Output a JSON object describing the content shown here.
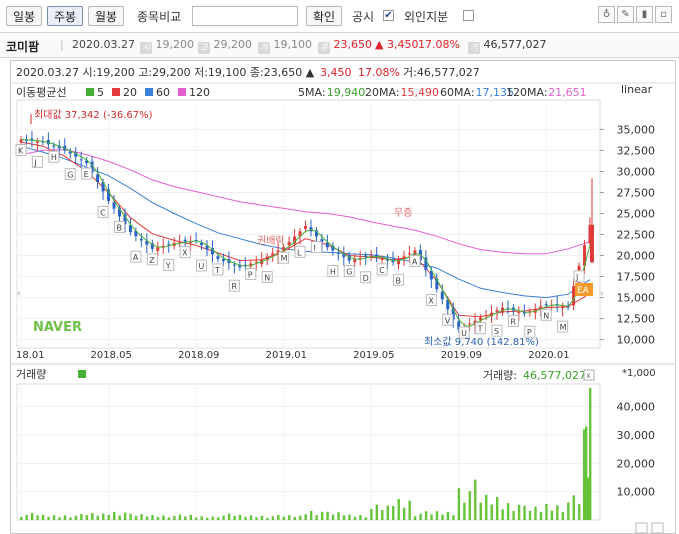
{
  "toolbar": {
    "day_label": "일봉",
    "week_label": "주봉",
    "month_label": "월봉",
    "compare_label": "종목비교",
    "confirm_label": "확인",
    "disclosure_label": "공시",
    "foreign_label": "외인지분"
  },
  "info": {
    "name": "코미팜",
    "date": "2020.03.27",
    "open_icon": "시",
    "open": "19,200",
    "high_icon": "고",
    "high": "29,200",
    "low_icon": "저",
    "low": "19,100",
    "close_icon": "종",
    "close": "23,650",
    "change": "▲ 3,450",
    "pct": "17.08%",
    "volume_icon": "거",
    "volume": "46,577,027"
  },
  "chart_header": {
    "ohlc": "2020.03.27 시:19,200 고:29,200 저:19,100 종:23,650 ▲",
    "change": "3,450",
    "pct": "17.08%",
    "volume": "거:46,577,027",
    "ma_title": "이동평균선",
    "ma_items": [
      {
        "label": "5",
        "color": "#45b035"
      },
      {
        "label": "20",
        "color": "#e23a3a"
      },
      {
        "label": "60",
        "color": "#3a7fd8"
      },
      {
        "label": "120",
        "color": "#e35fcf"
      }
    ],
    "ma_values": [
      {
        "label": "5MA:",
        "value": "19,940",
        "color": "#3aa02a"
      },
      {
        "label": "20MA:",
        "value": "15,490",
        "color": "#e23a3a"
      },
      {
        "label": "60MA:",
        "value": "17,135",
        "color": "#3a7fd8"
      },
      {
        "label": "120MA:",
        "value": "21,651",
        "color": "#e35fcf"
      }
    ],
    "scale": "linear",
    "max_label": "최대값 37,342 (-36.67%)",
    "min_label": "최소값 9,740 (142.81%)",
    "annot1": "권배락",
    "annot2": "무증",
    "watermark": "NAVER",
    "volume_title": "거래량",
    "volume_value_label": "거래량:",
    "volume_value": "46,577,027",
    "volume_unit": "*1,000"
  },
  "chart_data": [
    {
      "type": "candlestick",
      "title": "",
      "x": [
        "18.01",
        "18.02",
        "18.03",
        "18.04",
        "18.05",
        "18.06",
        "18.07",
        "18.08",
        "18.09",
        "18.10",
        "18.11",
        "18.12",
        "19.01",
        "19.02",
        "19.03",
        "19.04",
        "19.05",
        "19.06",
        "19.07",
        "19.08",
        "19.09",
        "19.10",
        "19.11",
        "19.12",
        "20.01",
        "20.02",
        "20.03"
      ],
      "x_tick_labels": [
        "18.01",
        "2018.05",
        "2018.09",
        "2019.01",
        "2019.05",
        "2019.09",
        "2020.01"
      ],
      "y_tick_labels": [
        "10,000",
        "12,500",
        "15,000",
        "17,500",
        "20,000",
        "22,500",
        "25,000",
        "27,500",
        "30,000",
        "32,500",
        "35,000"
      ],
      "ylim": [
        9000,
        38500
      ],
      "close": [
        33800,
        33500,
        32500,
        31000,
        26500,
        22800,
        20800,
        21500,
        21800,
        19600,
        18600,
        19500,
        21000,
        23500,
        21000,
        19400,
        20000,
        19200,
        20600,
        16000,
        11200,
        12600,
        13800,
        13100,
        14200,
        13900,
        23650
      ],
      "ma_120_approx": [
        32000,
        32500,
        32600,
        32000,
        31200,
        30200,
        29000,
        28200,
        27600,
        27000,
        26400,
        26000,
        25600,
        25200,
        25000,
        24600,
        24000,
        23500,
        23000,
        22300,
        21400,
        20700,
        20400,
        20200,
        20200,
        20800,
        21651
      ],
      "ma_60_approx": [
        33000,
        32300,
        31500,
        30500,
        29500,
        28000,
        26300,
        25000,
        23800,
        22700,
        22000,
        21300,
        20800,
        20500,
        20400,
        20200,
        20100,
        19700,
        19200,
        18500,
        17200,
        16100,
        15600,
        15200,
        15000,
        15400,
        17135
      ],
      "ma_20_approx": [
        33500,
        33000,
        31800,
        30000,
        27500,
        24500,
        22600,
        21800,
        21200,
        20300,
        19400,
        19500,
        20500,
        22000,
        21300,
        20000,
        19800,
        19500,
        19900,
        17000,
        12900,
        12700,
        13300,
        13400,
        13800,
        13900,
        15490
      ],
      "max_value": 37342,
      "min_value": 9740
    },
    {
      "type": "bar",
      "title": "",
      "x": [
        "18.01",
        "18.02",
        "18.03",
        "18.04",
        "18.05",
        "18.06",
        "18.07",
        "18.08",
        "18.09",
        "18.10",
        "18.11",
        "18.12",
        "19.01",
        "19.02",
        "19.03",
        "19.04",
        "19.05",
        "19.06",
        "19.07",
        "19.08",
        "19.09",
        "19.10",
        "19.11",
        "19.12",
        "20.01",
        "20.02",
        "20.03"
      ],
      "values_thousands": [
        1800,
        1400,
        1500,
        1900,
        2600,
        1600,
        1500,
        1400,
        1100,
        1600,
        1400,
        1300,
        1300,
        2900,
        2100,
        1600,
        3900,
        6200,
        2200,
        2400,
        10200,
        6800,
        5400,
        3600,
        4700,
        6200,
        46577
      ],
      "y_tick_labels": [
        "10,000",
        "20,000",
        "30,000",
        "40,000"
      ],
      "ylim": [
        0,
        48000
      ]
    }
  ]
}
